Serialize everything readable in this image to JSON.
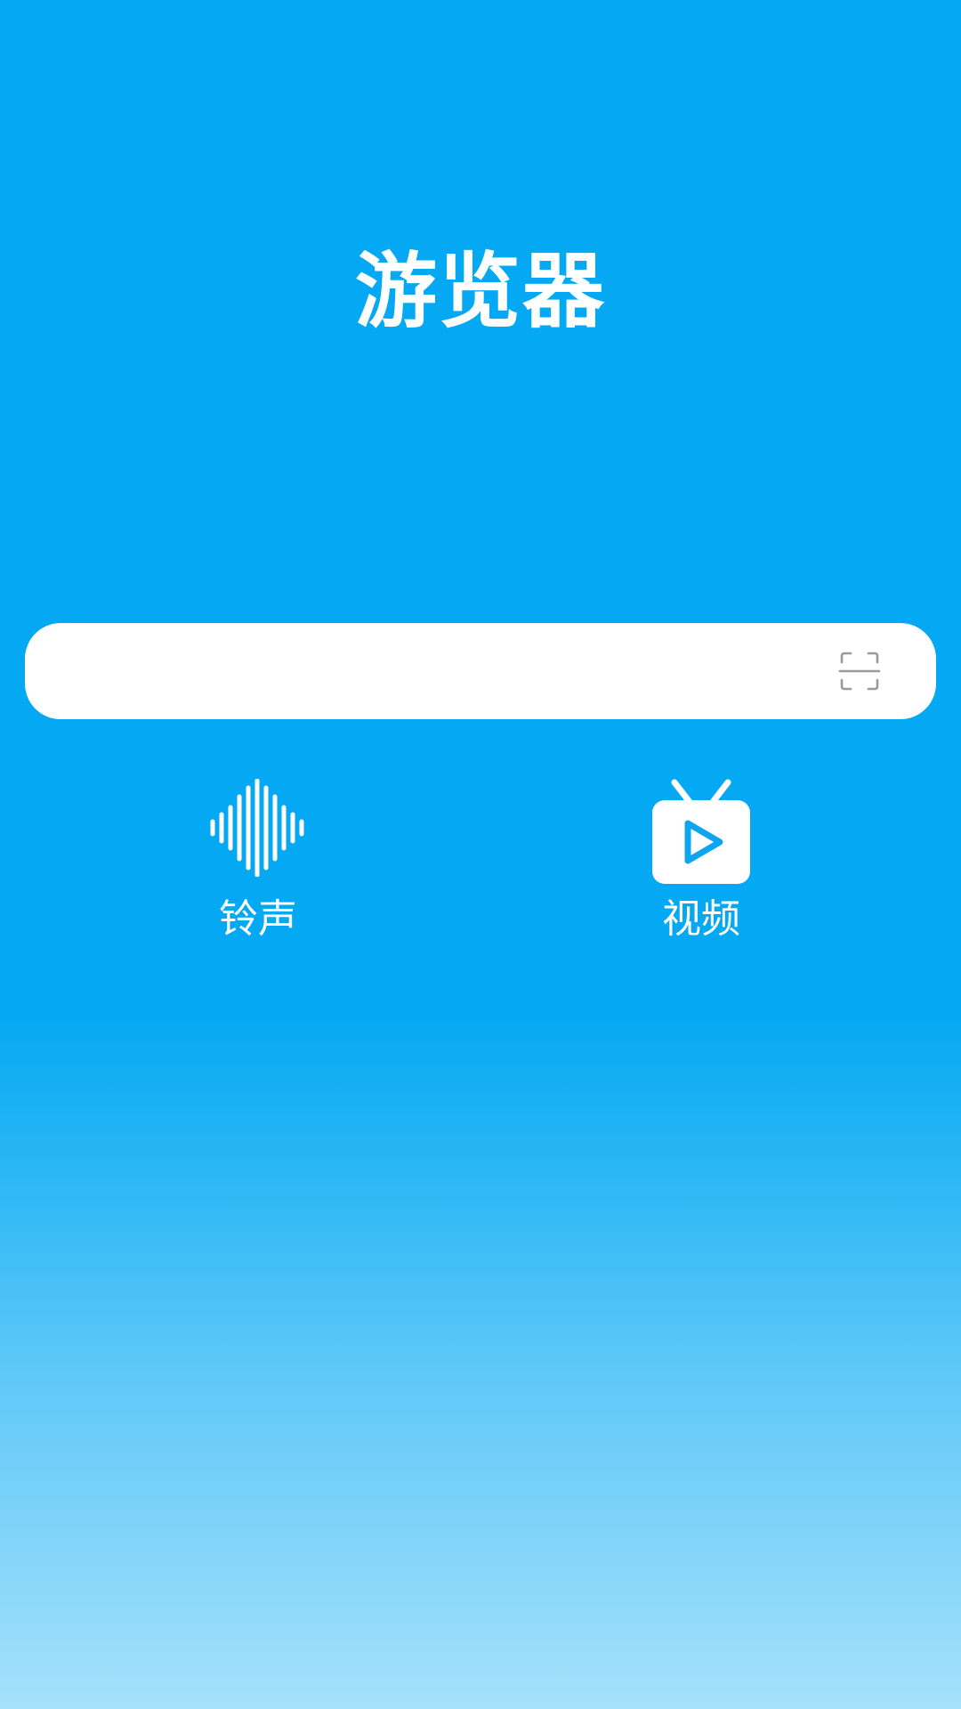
{
  "app": {
    "title": "游览器"
  },
  "search": {
    "value": "",
    "placeholder": "",
    "scan_icon": "scan-icon"
  },
  "shortcuts": [
    {
      "label": "铃声",
      "icon": "sound-wave-icon"
    },
    {
      "label": "视频",
      "icon": "tv-play-icon"
    }
  ],
  "colors": {
    "background_top": "#05a8f2",
    "background_bottom": "#a5e1fb",
    "icon_accent": "#0ba6ef",
    "text": "#ffffff"
  }
}
